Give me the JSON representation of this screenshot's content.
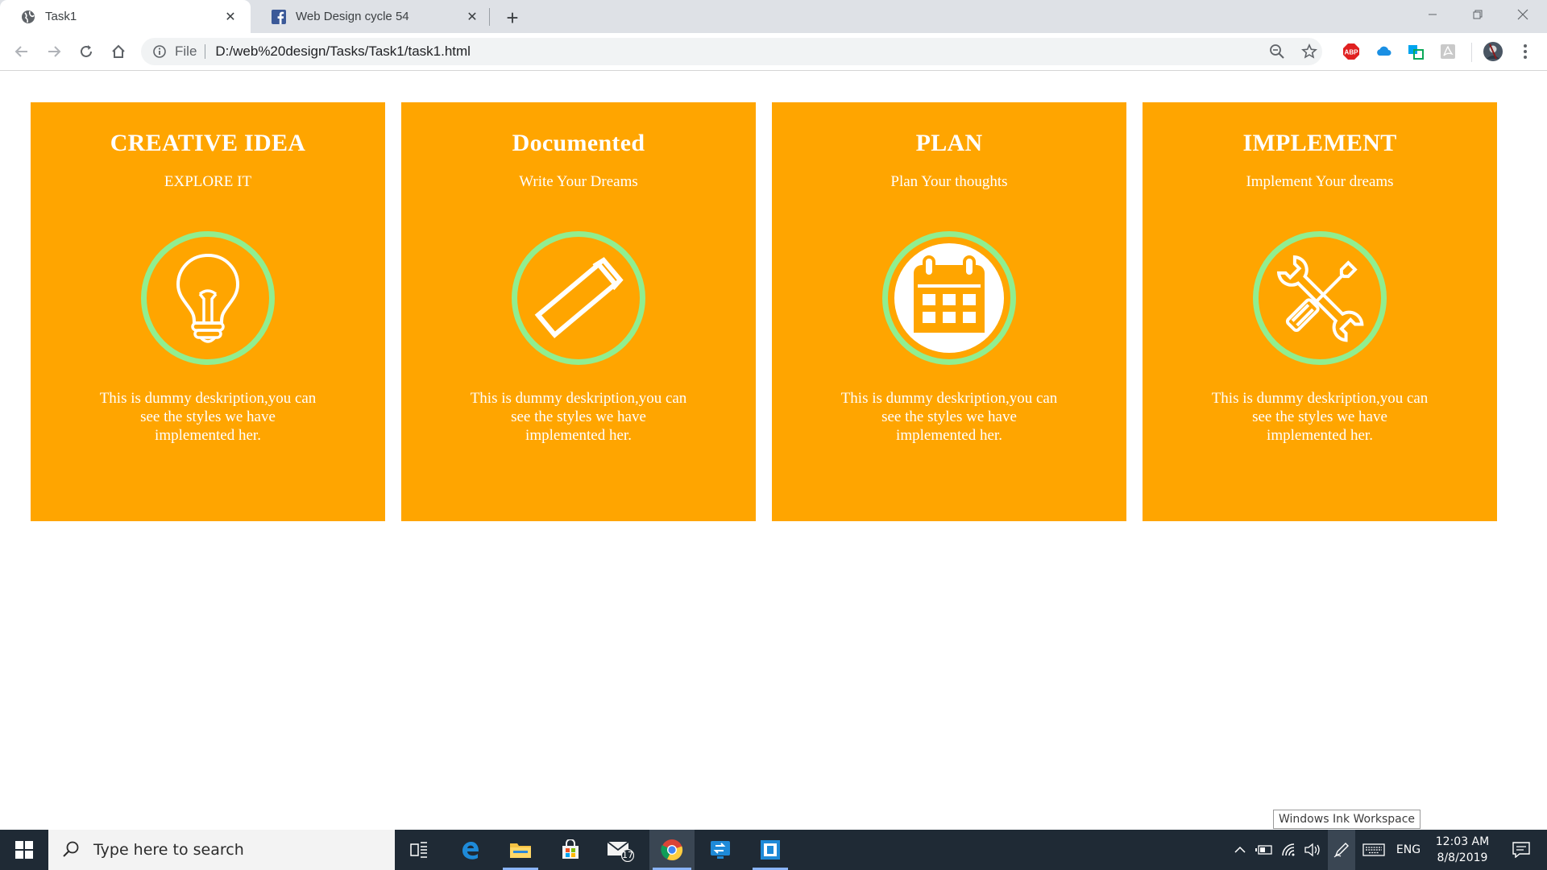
{
  "browser": {
    "tabs": [
      {
        "title": "Task1",
        "icon": "globe-icon"
      },
      {
        "title": "Web Design cycle 54",
        "icon": "facebook-icon"
      }
    ],
    "address": {
      "scheme_label": "File",
      "url": "D:/web%20design/Tasks/Task1/task1.html"
    }
  },
  "cards": [
    {
      "title": "CREATIVE IDEA",
      "subtitle": "EXPLORE IT",
      "icon": "lightbulb-icon",
      "description": "This is dummy deskription,you can see the styles we have implemented her."
    },
    {
      "title": "Documented",
      "subtitle": "Write Your Dreams",
      "icon": "pencil-icon",
      "description": "This is dummy deskription,you can see the styles we have implemented her."
    },
    {
      "title": "PLAN",
      "subtitle": "Plan Your thoughts",
      "icon": "calendar-icon",
      "description": "This is dummy deskription,you can see the styles we have implemented her."
    },
    {
      "title": "IMPLEMENT",
      "subtitle": "Implement Your dreams",
      "icon": "tools-icon",
      "description": "This is dummy deskription,you can see the styles we have implemented her."
    }
  ],
  "colors": {
    "card_background": "#ffa500",
    "icon_ring": "#90ee90",
    "taskbar": "#1f2a35"
  },
  "tooltip": {
    "text": "Windows Ink Workspace"
  },
  "taskbar": {
    "search_placeholder": "Type here to search",
    "mail_badge": "17",
    "language": "ENG",
    "time": "12:03 AM",
    "date": "8/8/2019"
  }
}
